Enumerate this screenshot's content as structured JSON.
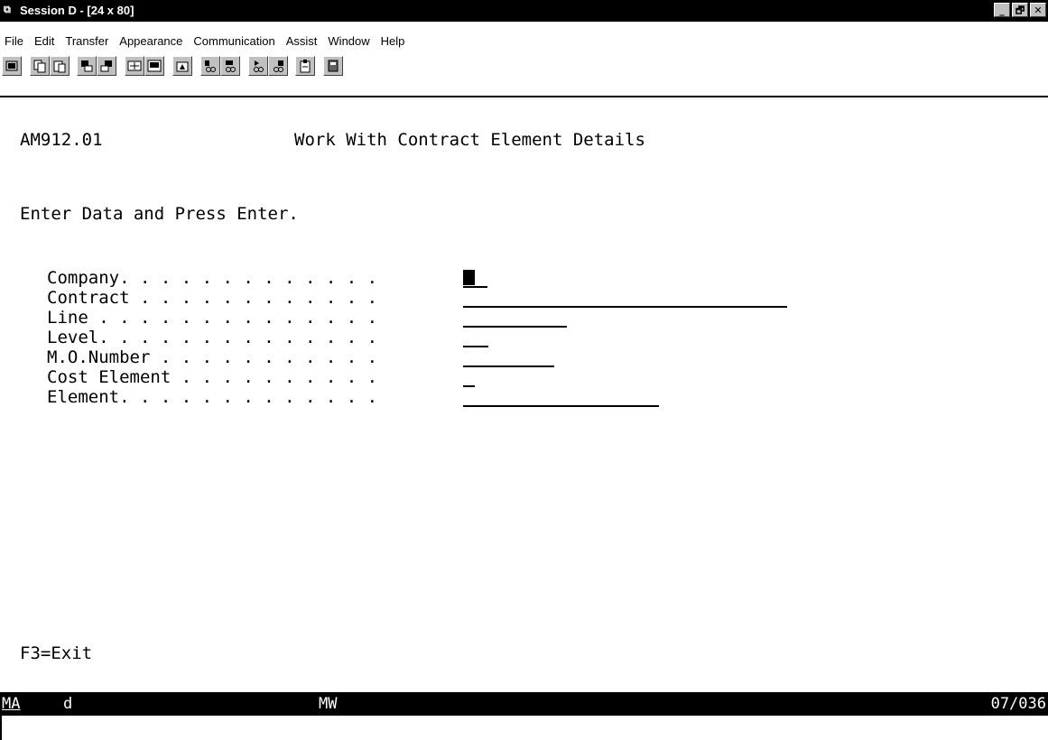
{
  "window": {
    "title": "Session D - [24 x 80]",
    "buttons": [
      "_",
      "🗗",
      "✕"
    ]
  },
  "menu": {
    "items": [
      {
        "label": "File"
      },
      {
        "label": "Edit"
      },
      {
        "label": "Transfer"
      },
      {
        "label": "Appearance"
      },
      {
        "label": "Communication"
      },
      {
        "label": "Assist"
      },
      {
        "label": "Window"
      },
      {
        "label": "Help"
      }
    ]
  },
  "toolbar": {
    "icons": [
      "print-screen-icon",
      "copy-icon",
      "paste-icon",
      "send-icon",
      "receive-icon",
      "keyboard-icon",
      "display-setup-icon",
      "macro-icon",
      "record-icon",
      "play-icon",
      "stop-macro-icon",
      "start-macro-icon",
      "clipboard-icon",
      "book-icon"
    ]
  },
  "screen": {
    "program_id": "AM912.01",
    "title": "Work With Contract Element Details",
    "instruction": "Enter Data and Press Enter.",
    "fields": [
      {
        "label": "Company. . . . . . . . . . . . .",
        "value": ""
      },
      {
        "label": "Contract . . . . . . . . . . . .",
        "value": ""
      },
      {
        "label": "Line . . . . . . . . . . . . . .",
        "value": ""
      },
      {
        "label": "Level. . . . . . . . . . . . . .",
        "value": ""
      },
      {
        "label": "M.O.Number . . . . . . . . . . .",
        "value": ""
      },
      {
        "label": "Cost Element . . . . . . . . . .",
        "value": ""
      },
      {
        "label": "Element. . . . . . . . . . . . .",
        "value": ""
      }
    ],
    "function_keys": "F3=Exit"
  },
  "status": {
    "indicator": "MA",
    "mode": "d",
    "message_waiting": "MW",
    "cursor_position": "07/036"
  }
}
